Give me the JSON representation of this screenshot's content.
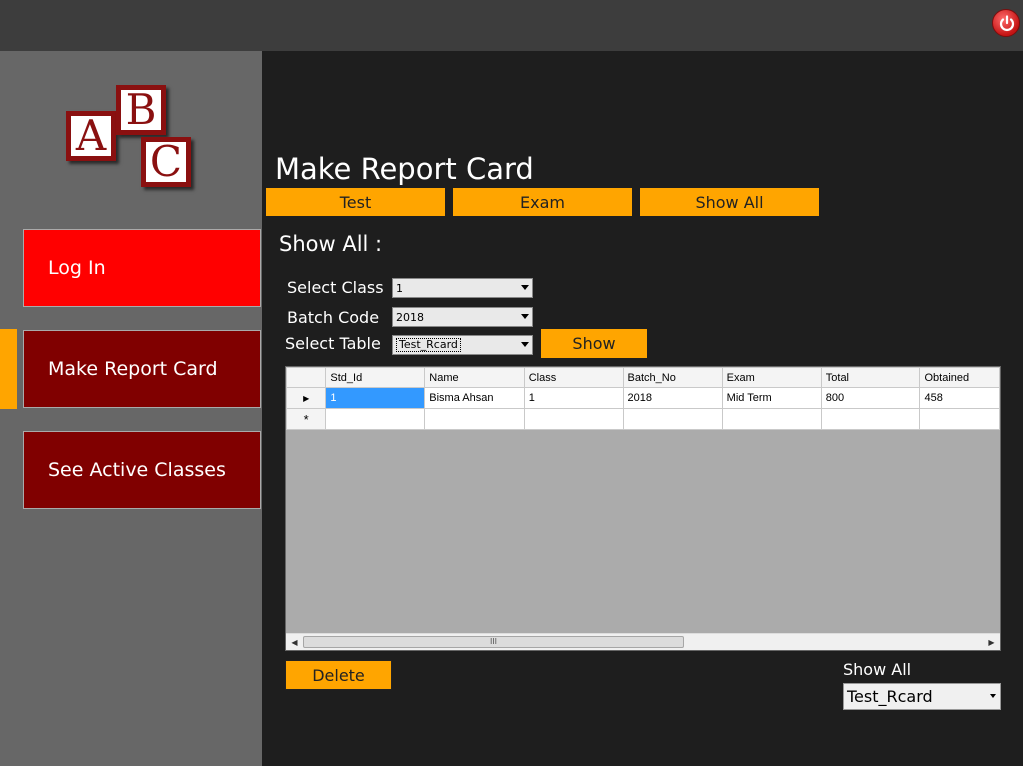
{
  "header": {
    "power_icon": "power-icon"
  },
  "logo": {
    "letters": [
      "A",
      "B",
      "C"
    ]
  },
  "sidebar": {
    "items": [
      {
        "label": "Log In",
        "color": "#ff0000"
      },
      {
        "label": "Make Report Card",
        "color": "#800000",
        "active": true
      },
      {
        "label": "See Active Classes",
        "color": "#800000"
      }
    ]
  },
  "main": {
    "title": "Make Report Card",
    "tabs": [
      {
        "label": "Test"
      },
      {
        "label": "Exam"
      },
      {
        "label": "Show All"
      }
    ],
    "section_title": "Show All :",
    "form": {
      "class_label": "Select Class",
      "class_value": "1",
      "batch_label": "Batch Code",
      "batch_value": "2018",
      "table_label": "Select Table",
      "table_value": "Test_Rcard",
      "show_button": "Show"
    },
    "grid": {
      "columns": [
        "Std_Id",
        "Name",
        "Class",
        "Batch_No",
        "Exam",
        "Total",
        "Obtained"
      ],
      "rows": [
        [
          "1",
          "Bisma Ahsan",
          "1",
          "2018",
          "Mid Term",
          "800",
          "458"
        ]
      ],
      "current_row_marker": "▶",
      "new_row_marker": "*",
      "scroll_grip": "III"
    },
    "delete_button": "Delete",
    "show_all_label": "Show All",
    "show_all_value": "Test_Rcard"
  },
  "colors": {
    "accent": "#ffa500",
    "background": "#1e1e1e",
    "sidebar": "#676767",
    "topbar": "#3d3d3d"
  }
}
